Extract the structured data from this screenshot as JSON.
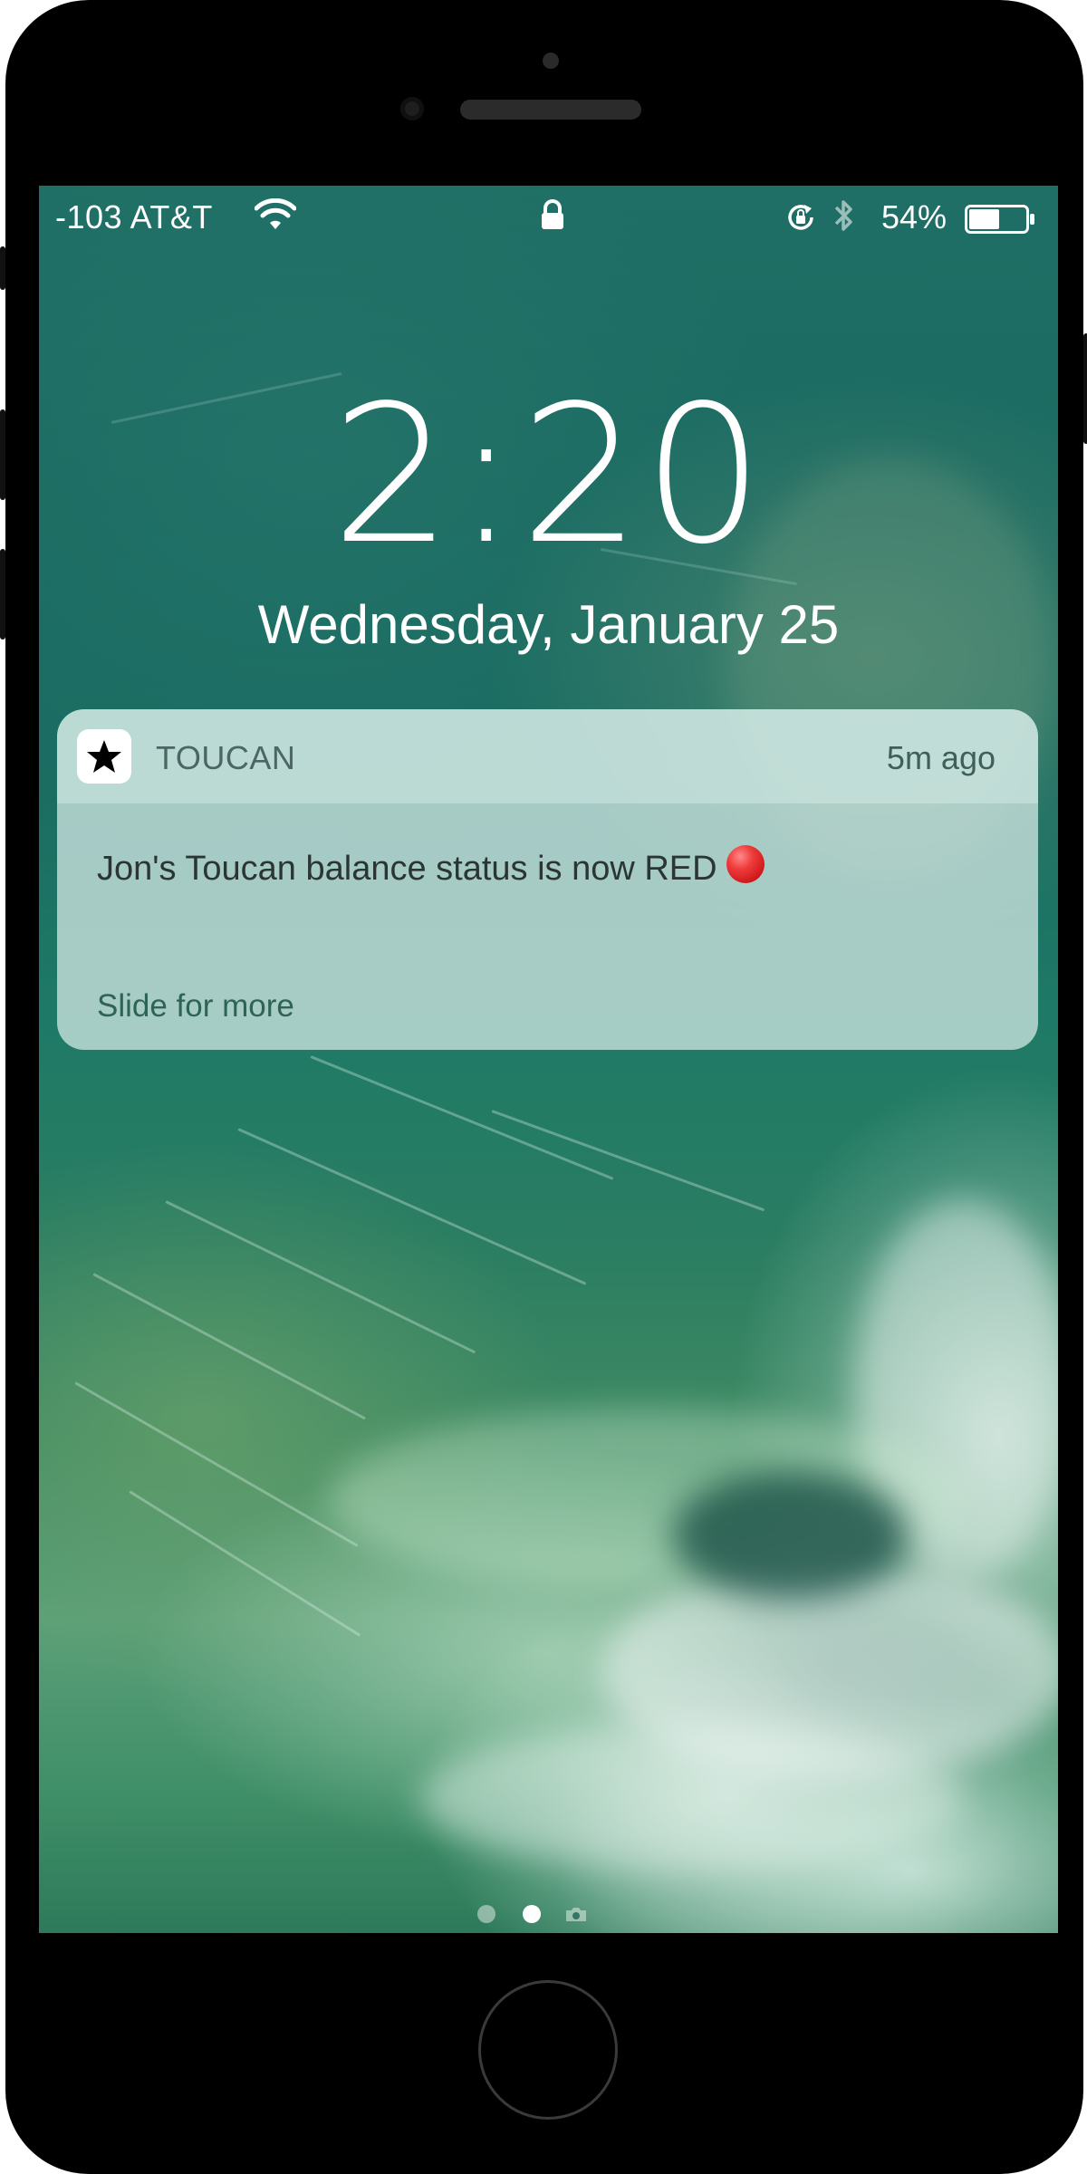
{
  "status_bar": {
    "carrier": "-103 AT&T",
    "battery_percent": "54%",
    "battery_level": 0.54,
    "icons": [
      "wifi-icon",
      "lock-icon",
      "orientation-lock-icon",
      "bluetooth-icon",
      "battery-icon"
    ]
  },
  "lock_screen": {
    "time": "2:20",
    "date": "Wednesday, January 25"
  },
  "notification": {
    "app_name": "TOUCAN",
    "app_icon": "star-icon",
    "time_ago": "5m ago",
    "message": "Jon's Toucan balance status is now RED",
    "emoji": "red-circle",
    "action_hint": "Slide for more"
  },
  "page_indicator": {
    "pages": 3,
    "current": 2,
    "last_icon": "camera-icon"
  },
  "colors": {
    "notification_bg": "#cde4e0",
    "text_primary": "#2b3533",
    "app_name": "#4c6663",
    "action_hint": "#2f6454",
    "red_dot": "#e02020",
    "device_frame": "#000000"
  }
}
